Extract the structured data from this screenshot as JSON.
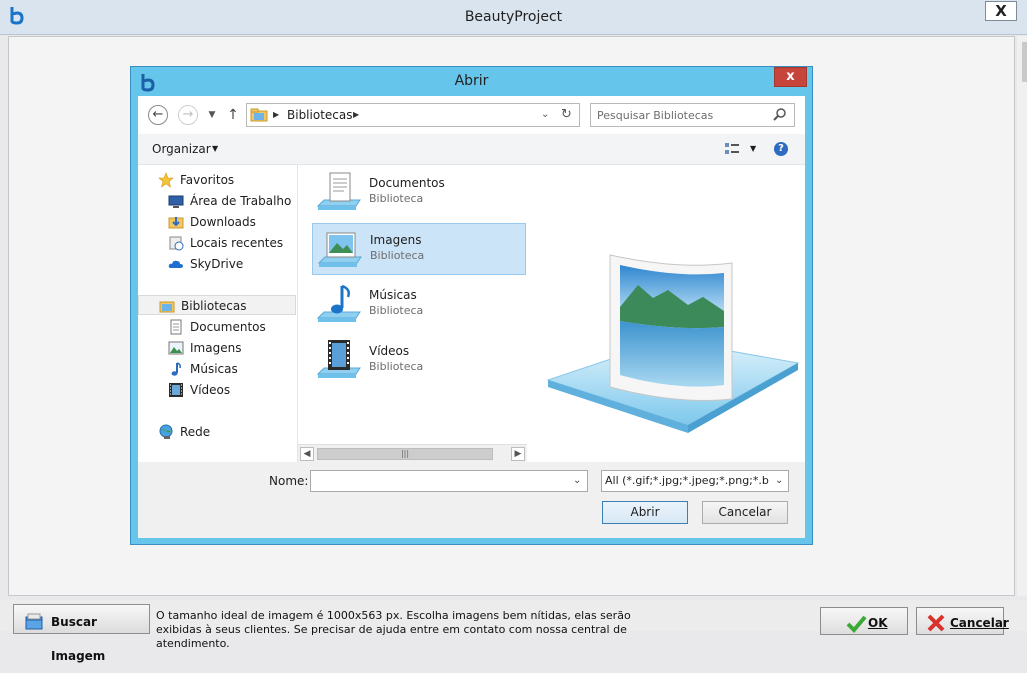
{
  "app": {
    "title": "BeautyProject",
    "close_label": "X"
  },
  "dialog": {
    "title": "Abrir",
    "close_label": "x",
    "address": {
      "path": "Bibliotecas"
    },
    "search": {
      "placeholder": "Pesquisar Bibliotecas"
    },
    "toolbar": {
      "organize_label": "Organizar"
    },
    "nav_pane": {
      "favorites": {
        "label": "Favoritos",
        "items": [
          "Área de Trabalho",
          "Downloads",
          "Locais recentes",
          "SkyDrive"
        ]
      },
      "libraries": {
        "label": "Bibliotecas",
        "items": [
          "Documentos",
          "Imagens",
          "Músicas",
          "Vídeos"
        ]
      },
      "network": {
        "label": "Rede"
      }
    },
    "files": [
      {
        "name": "Documentos",
        "type": "Biblioteca"
      },
      {
        "name": "Imagens",
        "type": "Biblioteca",
        "selected": true
      },
      {
        "name": "Músicas",
        "type": "Biblioteca"
      },
      {
        "name": "Vídeos",
        "type": "Biblioteca"
      }
    ],
    "footer": {
      "name_label": "Nome:",
      "name_value": "",
      "filter_value": "All (*.gif;*.jpg;*.jpeg;*.png;*.bmp)",
      "open_label": "Abrir",
      "cancel_label": "Cancelar"
    }
  },
  "bottom_bar": {
    "search_image_label": "Buscar Imagem",
    "hint": "O tamanho ideal de imagem é 1000x563 px. Escolha imagens bem nítidas, elas serão exibidas à seus clientes. Se precisar de ajuda entre em contato com nossa central de atendimento.",
    "ok_label": "OK",
    "cancel_label": "Cancelar"
  },
  "colors": {
    "dialog_frame": "#66c5ea",
    "close_red": "#c7443a",
    "selection": "#cce4f7"
  }
}
